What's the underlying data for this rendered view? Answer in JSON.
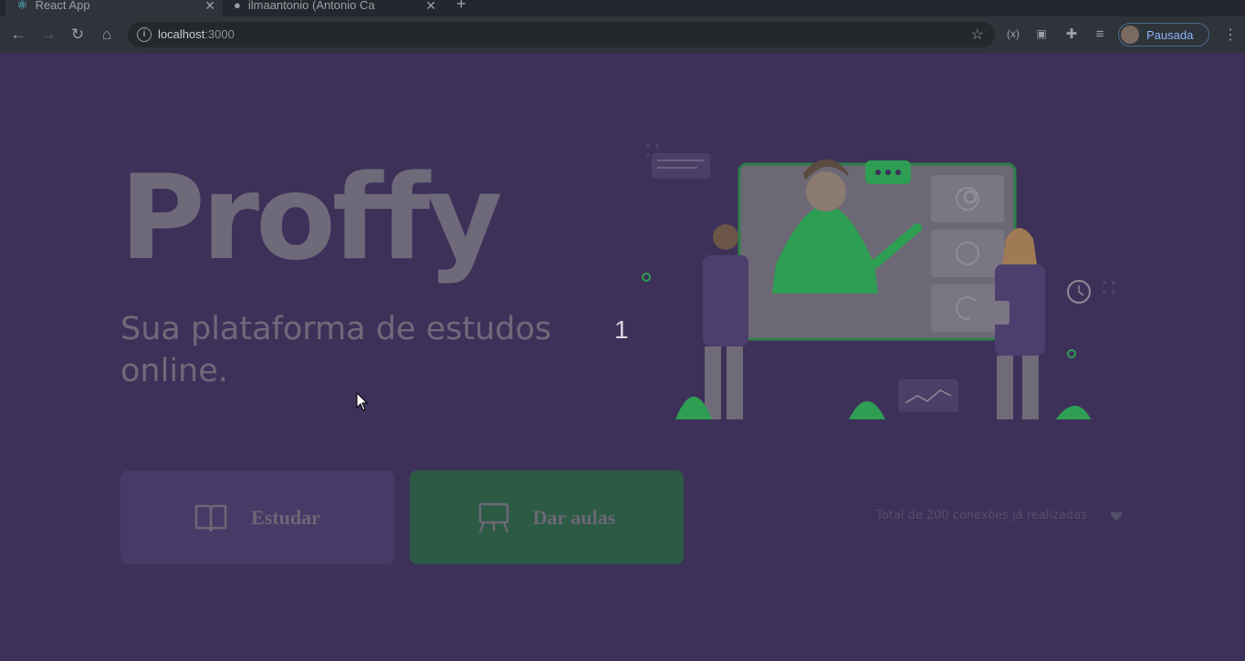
{
  "browser": {
    "tabs": [
      {
        "title": "React App",
        "icon": "react-icon"
      },
      {
        "title": "ilmaantonio (Antonio Ca",
        "icon": "github-icon"
      }
    ],
    "new_tab": "+",
    "url_host": "localhost",
    "url_port": ":3000",
    "profile_label": "Pausada"
  },
  "page": {
    "logo": "Proffy",
    "subtitle": "Sua plataforma de estudos online.",
    "marker": "1",
    "buttons": {
      "study": {
        "label": "Estudar",
        "icon": "book-open-icon"
      },
      "teach": {
        "label": "Dar aulas",
        "icon": "presentation-board-icon"
      }
    },
    "connections_text": "Total de 200 conexões já realizadas",
    "colors": {
      "background": "#3d3159",
      "study_button": "#473a66",
      "teach_button": "#2c5a45",
      "accent_green": "#2e9e53"
    }
  }
}
